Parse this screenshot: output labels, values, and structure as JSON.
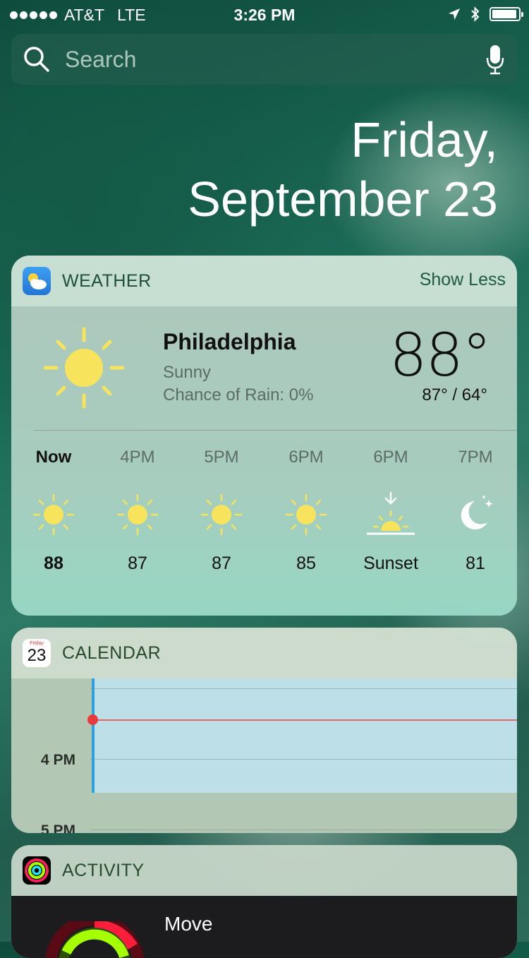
{
  "status": {
    "carrier": "AT&T",
    "network": "LTE",
    "time": "3:26 PM"
  },
  "search": {
    "placeholder": "Search"
  },
  "date": {
    "day": "Friday,",
    "full": "September 23"
  },
  "weather": {
    "title": "WEATHER",
    "show_less": "Show Less",
    "city": "Philadelphia",
    "condition": "Sunny",
    "rain": "Chance of Rain: 0%",
    "temp": "88°",
    "hilo": "87° / 64°",
    "hours": [
      {
        "label": "Now",
        "icon": "sun-icon",
        "temp": "88"
      },
      {
        "label": "4PM",
        "icon": "sun-icon",
        "temp": "87"
      },
      {
        "label": "5PM",
        "icon": "sun-icon",
        "temp": "87"
      },
      {
        "label": "6PM",
        "icon": "sun-icon",
        "temp": "85"
      },
      {
        "label": "6PM",
        "icon": "sunset-icon",
        "temp": "Sunset"
      },
      {
        "label": "7PM",
        "icon": "moon-icon",
        "temp": "81"
      }
    ]
  },
  "calendar": {
    "title": "CALENDAR",
    "icon_day": "Friday",
    "icon_date": "23",
    "hour1": "4 PM",
    "hour2": "5 PM"
  },
  "activity": {
    "title": "ACTIVITY",
    "move": "Move"
  },
  "colors": {
    "sun": "#f7e35c",
    "event": "#bfe2ee",
    "now_line": "#e83a3a",
    "calendar_bar": "#2d9fdc"
  }
}
